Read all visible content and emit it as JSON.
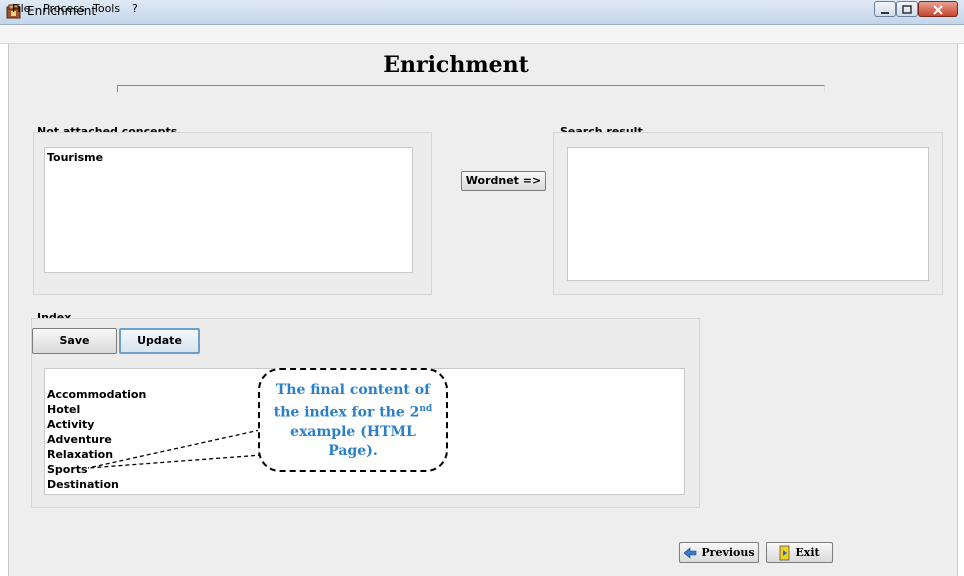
{
  "window": {
    "title": "Enrichment"
  },
  "menu": {
    "items": [
      "File",
      "Process",
      "Tools",
      "?"
    ]
  },
  "page": {
    "title": "Enrichment"
  },
  "not_attached": {
    "label": "Not attached concepts",
    "items": [
      "Tourisme"
    ]
  },
  "wordnet_button": "Wordnet =>",
  "search_result": {
    "label": "Search result",
    "items": []
  },
  "index": {
    "label": "Index",
    "save_label": "Save",
    "update_label": "Update",
    "items": [
      "Accommodation",
      "Hotel",
      "Activity",
      "Adventure",
      "Relaxation",
      "Sports",
      "Destination"
    ]
  },
  "callout": {
    "line1": "The final content of",
    "line2": "the index for the 2",
    "line2_sup": "nd",
    "line3": "example (HTML",
    "line4": "Page)."
  },
  "nav": {
    "previous_label": "Previous",
    "exit_label": "Exit"
  },
  "colors": {
    "callout_text": "#2a7fc8",
    "update_border": "#6d9fc9"
  }
}
